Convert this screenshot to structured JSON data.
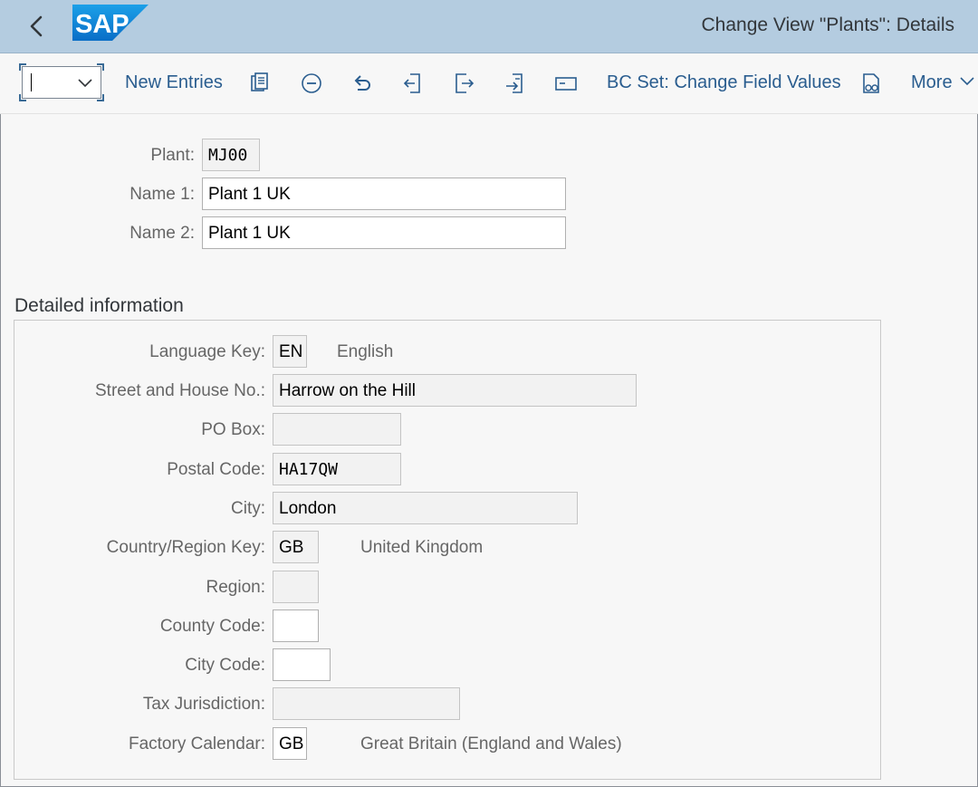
{
  "header": {
    "title": "Change View \"Plants\": Details",
    "logo_text": "SAP",
    "colors": {
      "shell_bar": "#b4cce0",
      "logo_blue": "#1f8ad6",
      "link": "#2a5d8f"
    }
  },
  "toolbar": {
    "command_field_value": "",
    "new_entries_label": "New Entries",
    "bc_set_label": "BC Set: Change Field Values",
    "more_label": "More",
    "icons": [
      "clipboard-icon",
      "delete-icon",
      "undo-icon",
      "first-entry-icon",
      "prev-entry-icon",
      "next-entry-icon",
      "last-entry-icon",
      "bc-set-icon"
    ]
  },
  "plant_header": {
    "plant_label": "Plant:",
    "plant_value": "MJ00",
    "name1_label": "Name 1:",
    "name1_value": "Plant 1 UK",
    "name2_label": "Name 2:",
    "name2_value": "Plant 1 UK"
  },
  "detailed": {
    "section_title": "Detailed information",
    "language_key": {
      "label": "Language Key:",
      "value": "EN",
      "description": "English"
    },
    "street": {
      "label": "Street and House No.:",
      "value": "Harrow on the Hill"
    },
    "po_box": {
      "label": "PO Box:",
      "value": ""
    },
    "postal_code": {
      "label": "Postal Code:",
      "value": "HA17QW"
    },
    "city": {
      "label": "City:",
      "value": "London"
    },
    "country": {
      "label": "Country/Region Key:",
      "value": "GB",
      "description": "United Kingdom"
    },
    "region": {
      "label": "Region:",
      "value": ""
    },
    "county_code": {
      "label": "County Code:",
      "value": ""
    },
    "city_code": {
      "label": "City Code:",
      "value": ""
    },
    "tax_jurisdiction": {
      "label": "Tax Jurisdiction:",
      "value": ""
    },
    "factory_calendar": {
      "label": "Factory Calendar:",
      "value": "GB",
      "description": "Great Britain (England and Wales)"
    }
  }
}
